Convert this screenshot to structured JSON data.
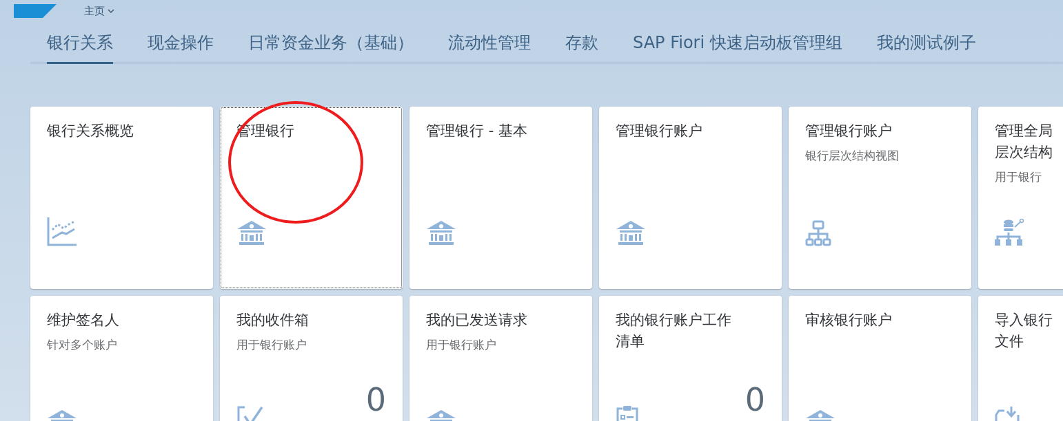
{
  "header": {
    "title": "主页"
  },
  "tabs": [
    {
      "label": "银行关系",
      "selected": true
    },
    {
      "label": "现金操作",
      "selected": false
    },
    {
      "label": "日常资金业务（基础）",
      "selected": false
    },
    {
      "label": "流动性管理",
      "selected": false
    },
    {
      "label": "存款",
      "selected": false
    },
    {
      "label": "SAP Fiori 快速启动板管理组",
      "selected": false
    },
    {
      "label": "我的测试例子",
      "selected": false
    }
  ],
  "tiles": [
    {
      "title_lines": [
        "银行关系概览"
      ],
      "kind": "chart",
      "focused": false
    },
    {
      "title_lines": [
        "管理银行"
      ],
      "kind": "bank",
      "focused": true
    },
    {
      "title_lines": [
        "管理银行 - 基本"
      ],
      "kind": "bank",
      "focused": false
    },
    {
      "title_lines": [
        "管理银行账户"
      ],
      "kind": "bank",
      "focused": false
    },
    {
      "title_lines": [
        "管理银行账户"
      ],
      "subtitle": "银行层次结构视图",
      "kind": "hierarchy",
      "focused": false
    },
    {
      "title_lines": [
        "管理全局",
        "层次结构"
      ],
      "subtitle": "用于银行",
      "kind": "dbhierarchy",
      "focused": false
    },
    {
      "title_lines": [
        "维护签名人"
      ],
      "subtitle": "针对多个账户",
      "kind": "bank",
      "focused": false
    },
    {
      "title_lines": [
        "我的收件箱"
      ],
      "subtitle": "用于银行账户",
      "kind": "check",
      "count": "0",
      "focused": false
    },
    {
      "title_lines": [
        "我的已发送请求"
      ],
      "subtitle": "用于银行账户",
      "kind": "bank",
      "focused": false
    },
    {
      "title_lines": [
        "我的银行账户工作",
        "清单"
      ],
      "kind": "clipboard",
      "count": "0",
      "focused": false
    },
    {
      "title_lines": [
        "审核银行账户"
      ],
      "kind": "bank",
      "focused": false
    },
    {
      "title_lines": [
        "导入银行",
        "文件"
      ],
      "kind": "upload",
      "focused": false
    }
  ]
}
